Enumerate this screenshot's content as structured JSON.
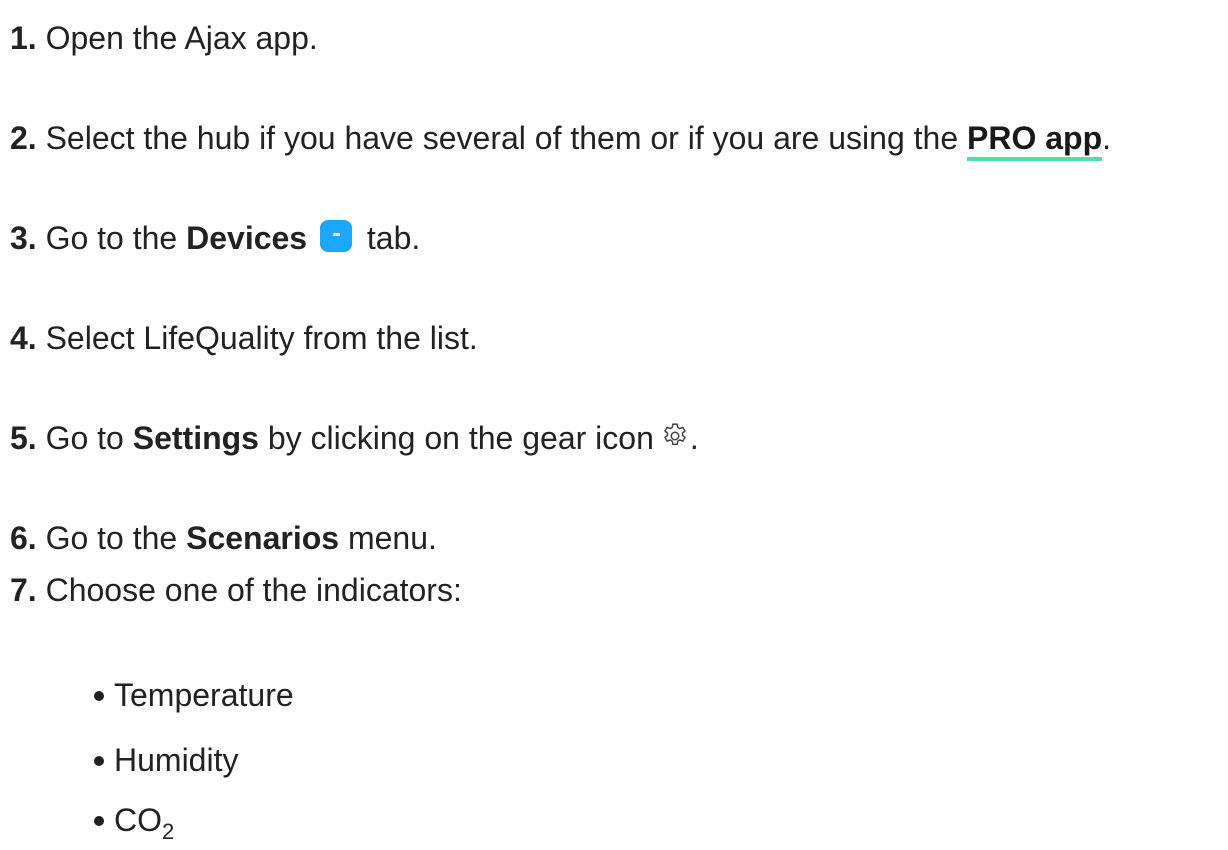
{
  "steps": [
    {
      "num": "1.",
      "text": "Open the Ajax app."
    },
    {
      "num": "2.",
      "pre": "Select the hub if you have several of them or if you are using the ",
      "link": "PRO app",
      "post": "."
    },
    {
      "num": "3.",
      "pre": "Go to the ",
      "bold": "Devices",
      "post": " tab.",
      "icon": "devices-icon"
    },
    {
      "num": "4.",
      "text": "Select LifeQuality from the list."
    },
    {
      "num": "5.",
      "pre": "Go to ",
      "bold": "Settings",
      "post": " by clicking on the gear icon",
      "icon": "gear-icon",
      "end": "."
    },
    {
      "num": "6.",
      "pre": "Go to the ",
      "bold": "Scenarios",
      "post": " menu."
    },
    {
      "num": "7.",
      "text": "Choose one of the indicators:"
    }
  ],
  "indicators": [
    {
      "label": "Temperature"
    },
    {
      "label": "Humidity"
    },
    {
      "label": "CO",
      "sub": "2"
    }
  ],
  "colors": {
    "text": "#222222",
    "link_underline": "#4fe0a6",
    "devices_icon": "#1ea7ff"
  }
}
